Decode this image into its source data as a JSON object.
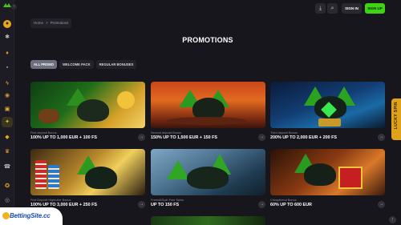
{
  "header": {
    "sign_in": "SIGN IN",
    "sign_up": "SIGN UP"
  },
  "breadcrumb": {
    "home": "Home",
    "separator": ">",
    "current": "Promotions"
  },
  "page": {
    "title": "PROMOTIONS"
  },
  "tabs": [
    {
      "label": "ALL PROMO",
      "active": true
    },
    {
      "label": "WELCOME PACK",
      "active": false
    },
    {
      "label": "REGULAR BONUSES",
      "active": false
    }
  ],
  "cards": [
    {
      "subtitle": "First deposit Bonus",
      "title": "100% UP TO 1,000 EUR + 100 FS"
    },
    {
      "subtitle": "Second deposit Bonus",
      "title": "150% UP TO 1,500 EUR + 150 FS"
    },
    {
      "subtitle": "Third deposit Bonus",
      "title": "200% UP TO 2,000 EUR + 200 FS"
    },
    {
      "subtitle": "First Deposit Highroller Bonus",
      "title": "100% UP TO 3,000 EUR + 250 FS"
    },
    {
      "subtitle": "Freeroll/Spin Free Spins",
      "title": "UP TO 150 FS"
    },
    {
      "subtitle": "Cheapfriend Bonus",
      "title": "60% UP TO 600 EUR"
    }
  ],
  "side_tab": {
    "label": "LUCKY SPIN"
  },
  "watermark": {
    "text": "BettingSite.cc"
  },
  "colors": {
    "background": "#17161d",
    "accent_green": "#3ed40f",
    "active_tab": "#6e7080",
    "gold": "#e0a21a"
  }
}
